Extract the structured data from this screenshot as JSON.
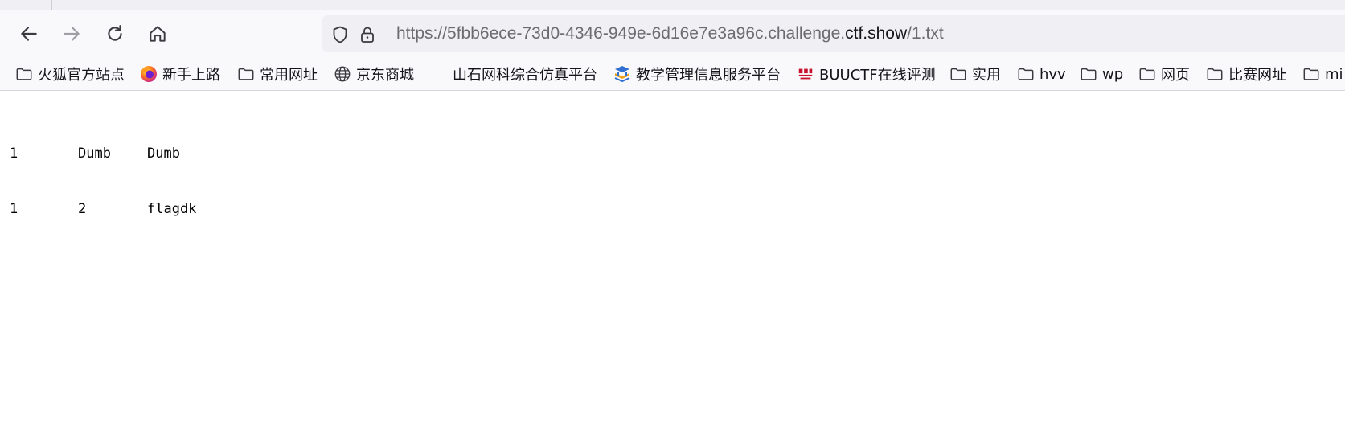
{
  "toolbar": {
    "back": "back",
    "forward": "forward",
    "reload": "reload",
    "home": "home"
  },
  "urlbar": {
    "prefix": "https://5fbb6ece-73d0-4346-949e-6d16e7e3a96c.challenge.",
    "host": "ctf.show",
    "path": "/1.txt",
    "icons": [
      "shield-icon",
      "lock-icon"
    ]
  },
  "bookmarks": [
    {
      "label": "火狐官方站点",
      "icon": "folder-icon"
    },
    {
      "label": "新手上路",
      "icon": "firefox-icon"
    },
    {
      "label": "常用网址",
      "icon": "folder-icon"
    },
    {
      "label": "京东商城",
      "icon": "globe-icon"
    },
    {
      "label": "山石网科综合仿真平台",
      "icon": "none"
    },
    {
      "label": "教学管理信息服务平台",
      "icon": "edu-logo-icon"
    },
    {
      "label": "BUUCTF在线评测",
      "icon": "buuctf-logo-icon"
    },
    {
      "label": "实用",
      "icon": "folder-icon"
    },
    {
      "label": "hvv",
      "icon": "folder-icon"
    },
    {
      "label": "wp",
      "icon": "folder-icon"
    },
    {
      "label": "网页",
      "icon": "folder-icon"
    },
    {
      "label": "比赛网址",
      "icon": "folder-icon"
    },
    {
      "label": "mi",
      "icon": "folder-icon"
    }
  ],
  "document": {
    "rows": [
      [
        "1",
        "Dumb",
        "Dumb"
      ],
      [
        "1",
        "2",
        "flagdk"
      ]
    ]
  },
  "colors": {
    "chrome": "#f9f9fb",
    "urlbar": "#f0f0f4",
    "url_dim": "#6b6b70",
    "url_host": "#15141a"
  }
}
